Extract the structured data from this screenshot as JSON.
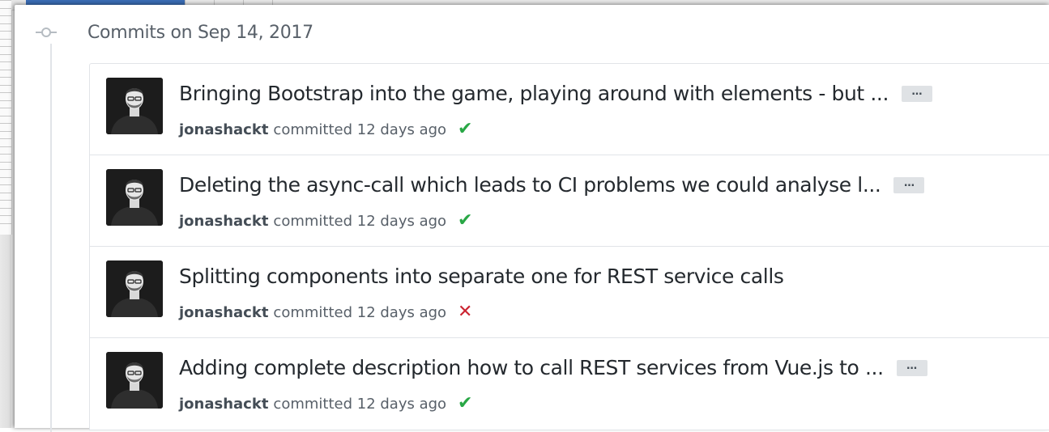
{
  "group": {
    "title": "Commits on Sep 14, 2017"
  },
  "commits": [
    {
      "title": "Bringing Bootstrap into the game, playing around with elements - but ...",
      "has_more": true,
      "more_label": "…",
      "author": "jonashackt",
      "meta": "committed 12 days ago",
      "status": "success",
      "status_glyph": "✔"
    },
    {
      "title": "Deleting the async-call which leads to CI problems we could analyse l...",
      "has_more": true,
      "more_label": "…",
      "author": "jonashackt",
      "meta": "committed 12 days ago",
      "status": "success",
      "status_glyph": "✔"
    },
    {
      "title": "Splitting components into separate one for REST service calls",
      "has_more": false,
      "more_label": "",
      "author": "jonashackt",
      "meta": "committed 12 days ago",
      "status": "failure",
      "status_glyph": "✕"
    },
    {
      "title": "Adding complete description how to call REST services from Vue.js to ...",
      "has_more": true,
      "more_label": "…",
      "author": "jonashackt",
      "meta": "committed 12 days ago",
      "status": "success",
      "status_glyph": "✔"
    }
  ],
  "icons": {
    "commit_node": "git-commit-icon",
    "success": "check-icon",
    "failure": "x-icon"
  },
  "colors": {
    "success": "#28a745",
    "failure": "#cb2431",
    "muted_text": "#586069",
    "border": "#e1e4e8"
  }
}
